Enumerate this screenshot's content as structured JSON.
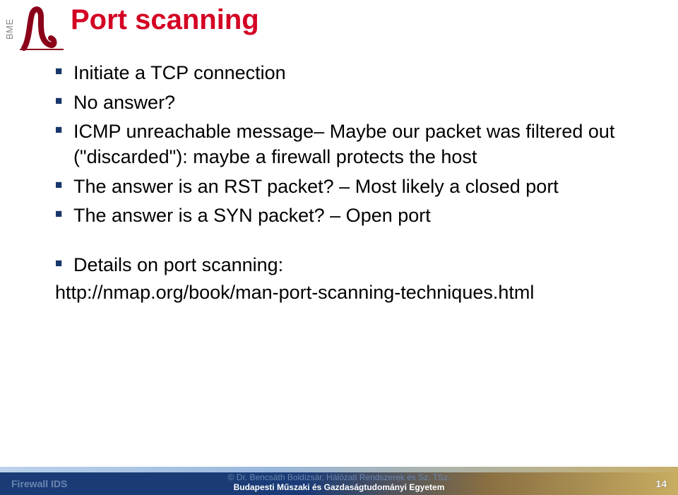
{
  "logo": {
    "bme": "BME"
  },
  "title": "Port scanning",
  "bullets": {
    "b1": "Initiate a TCP connection",
    "b2": "No answer?",
    "b3": "ICMP unreachable message– Maybe our packet was filtered out (\"discarded\"): maybe a  firewall protects the host",
    "b4": "The answer is an RST packet? – Most likely a closed port",
    "b5": "The answer is a SYN packet? – Open port",
    "b6": "Details on port scanning:"
  },
  "link": "http://nmap.org/book/man-port-scanning-techniques.html",
  "footer": {
    "left": "Firewall IDS",
    "line1": "© Dr. Bencsáth Boldizsár, Hálózati Rendszerek és Sz. TSz.",
    "line2": "Budapesti Műszaki és Gazdaságtudományi Egyetem",
    "pageNum": "14"
  }
}
